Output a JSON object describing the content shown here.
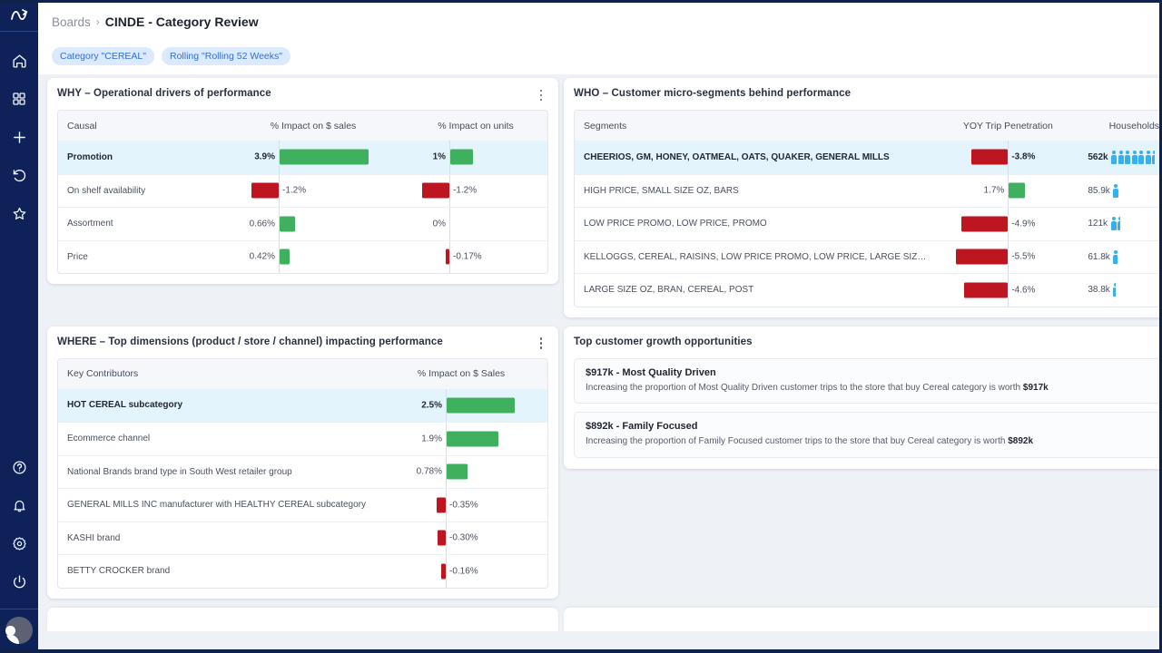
{
  "sidebar": {
    "logo": "brand-logo-icon",
    "items": [
      {
        "name": "home-icon",
        "label": "Home"
      },
      {
        "name": "apps-grid-icon",
        "label": "Boards"
      },
      {
        "name": "plus-icon",
        "label": "Create"
      },
      {
        "name": "history-icon",
        "label": "Recent"
      },
      {
        "name": "star-icon",
        "label": "Favorites"
      }
    ],
    "bottom_items": [
      {
        "name": "help-circle-icon",
        "label": "Help"
      },
      {
        "name": "bell-icon",
        "label": "Notifications"
      },
      {
        "name": "gear-icon",
        "label": "Settings"
      },
      {
        "name": "power-icon",
        "label": "Sign out"
      }
    ],
    "avatar": "user-avatar"
  },
  "header": {
    "breadcrumb_parent": "Boards",
    "breadcrumb_separator": "›",
    "breadcrumb_current": "CINDE - Category Review"
  },
  "filters": [
    {
      "label": "Category \"CEREAL\""
    },
    {
      "label": "Rolling \"Rolling 52 Weeks\""
    }
  ],
  "colors": {
    "positive": "#3fb05e",
    "negative": "#bd1620",
    "people": "#35b0f0",
    "highlight_row": "#e4f4fc",
    "chip_bg": "#dbeafe",
    "chip_text": "#2f6fdc",
    "sidebar_bg": "#0e2259"
  },
  "cards": {
    "why": {
      "title": "WHY – Operational drivers of performance",
      "menu": "kebab-menu-icon",
      "columns": [
        "Causal",
        "% Impact on $ sales",
        "% Impact on units"
      ],
      "rows": [
        {
          "label": "Promotion",
          "highlight": true,
          "sales_text": "3.9%",
          "sales_value": 3.9,
          "units_text": "1%",
          "units_value": 1.0
        },
        {
          "label": "On shelf availability",
          "highlight": false,
          "sales_text": "-1.2%",
          "sales_value": -1.2,
          "units_text": "-1.2%",
          "units_value": -1.2
        },
        {
          "label": "Assortment",
          "highlight": false,
          "sales_text": "0.66%",
          "sales_value": 0.66,
          "units_text": "0%",
          "units_value": 0
        },
        {
          "label": "Price",
          "highlight": false,
          "sales_text": "0.42%",
          "sales_value": 0.42,
          "units_text": "-0.17%",
          "units_value": -0.17
        }
      ]
    },
    "who": {
      "title": "WHO – Customer micro-segments behind performance",
      "menu": "kebab-menu-icon",
      "columns": [
        "Segments",
        "YOY Trip Penetration",
        "Households"
      ],
      "rows": [
        {
          "label": "CHEERIOS, GM, HONEY, OATMEAL, OATS, QUAKER, GENERAL MILLS",
          "highlight": true,
          "pen_text": "-3.8%",
          "pen_value": -3.8,
          "households_text": "562k",
          "households_value": 562,
          "people_icons": 6.5
        },
        {
          "label": "HIGH PRICE, SMALL SIZE OZ, BARS",
          "highlight": false,
          "pen_text": "1.7%",
          "pen_value": 1.7,
          "households_text": "85.9k",
          "households_value": 85.9,
          "people_icons": 1
        },
        {
          "label": "LOW PRICE PROMO, LOW PRICE, PROMO",
          "highlight": false,
          "pen_text": "-4.9%",
          "pen_value": -4.9,
          "households_text": "121k",
          "households_value": 121,
          "people_icons": 1.5
        },
        {
          "label": "KELLOGGS, CEREAL, RAISINS, LOW PRICE PROMO, LOW PRICE, LARGE SIZ…",
          "highlight": false,
          "pen_text": "-5.5%",
          "pen_value": -5.5,
          "households_text": "61.8k",
          "households_value": 61.8,
          "people_icons": 0.8
        },
        {
          "label": "LARGE SIZE OZ, BRAN, CEREAL, POST",
          "highlight": false,
          "pen_text": "-4.6%",
          "pen_value": -4.6,
          "households_text": "38.8k",
          "households_value": 38.8,
          "people_icons": 0.5
        }
      ]
    },
    "where": {
      "title": "WHERE – Top dimensions (product / store / channel) impacting performance",
      "menu": "kebab-menu-icon",
      "columns": [
        "Key Contributors",
        "% Impact on $ Sales"
      ],
      "rows": [
        {
          "label": "HOT CEREAL subcategory",
          "highlight": true,
          "text": "2.5%",
          "value": 2.5
        },
        {
          "label": "Ecommerce channel",
          "highlight": false,
          "text": "1.9%",
          "value": 1.9
        },
        {
          "label": "National Brands brand type in South West retailer group",
          "highlight": false,
          "text": "0.78%",
          "value": 0.78
        },
        {
          "label": "GENERAL MILLS INC manufacturer with HEALTHY CEREAL subcategory",
          "highlight": false,
          "text": "-0.35%",
          "value": -0.35
        },
        {
          "label": "KASHI brand",
          "highlight": false,
          "text": "-0.30%",
          "value": -0.3
        },
        {
          "label": "BETTY CROCKER brand",
          "highlight": false,
          "text": "-0.16%",
          "value": -0.16
        }
      ]
    },
    "growth": {
      "title": "Top customer growth opportunities",
      "menu": "kebab-menu-icon",
      "items": [
        {
          "title": "$917k - Most Quality Driven",
          "desc_prefix": "Increasing the proportion of Most Quality Driven customer trips to the store that buy Cereal category is worth ",
          "desc_amount": "$917k",
          "toggle": "chevron-up-icon"
        },
        {
          "title": "$892k - Family Focused",
          "desc_prefix": "Increasing the proportion of Family Focused customer trips to the store that buy Cereal category is worth ",
          "desc_amount": "$892k",
          "toggle": "chevron-up-icon"
        }
      ]
    }
  },
  "chart_data": [
    {
      "type": "bar",
      "title": "WHY – Operational drivers of performance",
      "orientation": "horizontal",
      "categories": [
        "Promotion",
        "On shelf availability",
        "Assortment",
        "Price"
      ],
      "series": [
        {
          "name": "% Impact on $ sales",
          "values": [
            3.9,
            -1.2,
            0.66,
            0.42
          ]
        },
        {
          "name": "% Impact on units",
          "values": [
            1.0,
            -1.2,
            0,
            -0.17
          ]
        }
      ],
      "xlabel": "% Impact",
      "ylabel": "Causal",
      "grid": false,
      "legend": "none"
    },
    {
      "type": "bar",
      "title": "WHO – Customer micro-segments behind performance",
      "orientation": "horizontal",
      "categories": [
        "CHEERIOS, GM, HONEY, OATMEAL, OATS, QUAKER, GENERAL MILLS",
        "HIGH PRICE, SMALL SIZE OZ, BARS",
        "LOW PRICE PROMO, LOW PRICE, PROMO",
        "KELLOGGS, CEREAL, RAISINS, LOW PRICE PROMO, LOW PRICE, LARGE SIZ…",
        "LARGE SIZE OZ, BRAN, CEREAL, POST"
      ],
      "series": [
        {
          "name": "YOY Trip Penetration",
          "values": [
            -3.8,
            1.7,
            -4.9,
            -5.5,
            -4.6
          ]
        },
        {
          "name": "Households (k)",
          "values": [
            562,
            85.9,
            121,
            61.8,
            38.8
          ]
        }
      ],
      "xlabel": "%",
      "ylabel": "Segments",
      "grid": false,
      "legend": "none"
    },
    {
      "type": "bar",
      "title": "WHERE – Top dimensions (product / store / channel) impacting performance",
      "orientation": "horizontal",
      "categories": [
        "HOT CEREAL subcategory",
        "Ecommerce channel",
        "National Brands brand type in South West retailer group",
        "GENERAL MILLS INC manufacturer with HEALTHY CEREAL subcategory",
        "KASHI brand",
        "BETTY CROCKER brand"
      ],
      "values": [
        2.5,
        1.9,
        0.78,
        -0.35,
        -0.3,
        -0.16
      ],
      "xlabel": "% Impact on $ Sales",
      "ylabel": "Key Contributors",
      "grid": false,
      "legend": "none"
    }
  ]
}
